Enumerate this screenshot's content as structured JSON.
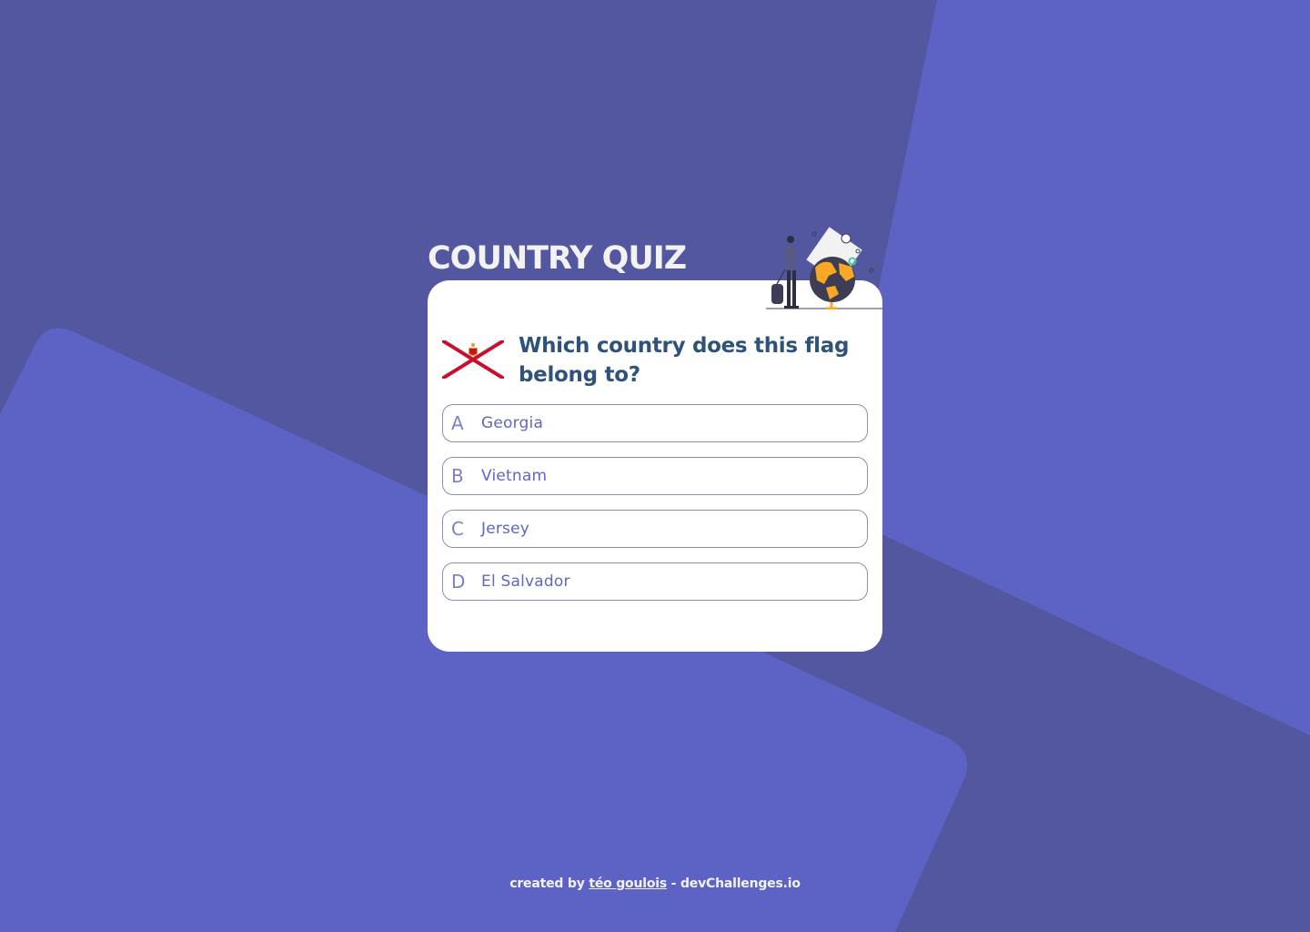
{
  "app": {
    "title": "COUNTRY QUIZ"
  },
  "question": {
    "text": "Which country does this flag belong to?",
    "flag_icon": "jersey-flag-icon"
  },
  "options": [
    {
      "letter": "A",
      "text": "Georgia"
    },
    {
      "letter": "B",
      "text": "Vietnam"
    },
    {
      "letter": "C",
      "text": "Jersey"
    },
    {
      "letter": "D",
      "text": "El Salvador"
    }
  ],
  "footer": {
    "prefix": "created by",
    "author": "téo goulois",
    "separator": "-",
    "site": "devChallenges.io"
  },
  "colors": {
    "background": "#5257A0",
    "shape": "#5D63C4",
    "card": "#FFFFFF",
    "title": "#F2F2F2",
    "question": "#2F527B",
    "option_text": "#6066D0",
    "option_border": "#8B8FAE",
    "flag_red": "#C8102E",
    "accent_orange": "#F9A826"
  }
}
